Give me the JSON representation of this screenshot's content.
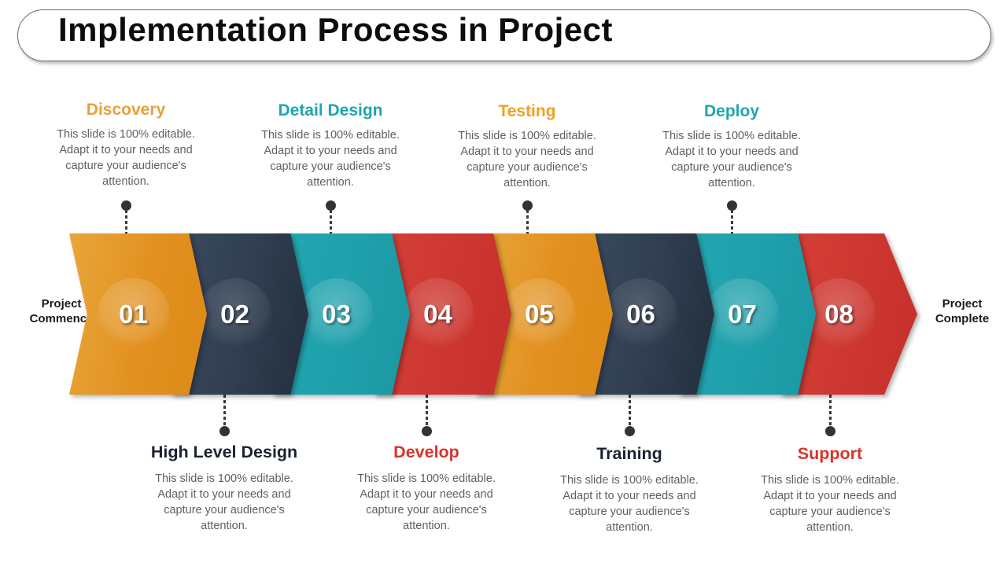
{
  "title": "Implementation  Process in Project",
  "endcaps": {
    "start": "Project\nCommence",
    "start_line1": "Project",
    "start_line2": "Commence",
    "end_line1": "Project",
    "end_line2": "Complete"
  },
  "colors": {
    "orange": "#E2901F",
    "navy": "#313F52",
    "teal": "#1FA0AB",
    "red": "#CD3731",
    "body_text": "#5F6062",
    "dark_heading": "#1A2330",
    "connector": "#333333"
  },
  "body_text": "This slide is 100% editable. Adapt it to your needs and capture your audience's attention.",
  "steps": [
    {
      "number": "01",
      "label": "Discovery",
      "color_name": "orange",
      "heading_color": "#E8A13A",
      "chip": "orange",
      "position": "top",
      "description": "This slide is 100% editable. Adapt it to your needs and capture your audience's attention."
    },
    {
      "number": "02",
      "label": "High Level Design",
      "color_name": "navy",
      "heading_color": "#1A2330",
      "chip": "navy",
      "position": "bottom",
      "description": "This slide is 100% editable. Adapt it to your needs and capture your audience's attention."
    },
    {
      "number": "03",
      "label": "Detail Design",
      "color_name": "teal",
      "heading_color": "#1FA5B0",
      "chip": "teal",
      "position": "top",
      "description": "This slide is 100% editable. Adapt it to your needs and capture your audience's attention."
    },
    {
      "number": "04",
      "label": "Develop",
      "color_name": "red",
      "heading_color": "#D8332B",
      "chip": "red",
      "position": "bottom",
      "description": "This slide is 100% editable. Adapt it to your needs and capture your audience's attention."
    },
    {
      "number": "05",
      "label": "Testing",
      "color_name": "orange",
      "heading_color": "#F2A01E",
      "chip": "orange",
      "position": "top",
      "description": "This slide is 100% editable. Adapt it to your needs and capture your audience's attention."
    },
    {
      "number": "06",
      "label": "Training",
      "color_name": "navy",
      "heading_color": "#1A2330",
      "chip": "navy",
      "position": "bottom",
      "description": "This slide is 100% editable. Adapt it to your needs and capture your audience's attention."
    },
    {
      "number": "07",
      "label": "Deploy",
      "color_name": "teal",
      "heading_color": "#1FA5B0",
      "chip": "teal",
      "position": "top",
      "description": "This slide is 100% editable. Adapt it to your needs and capture your audience's attention."
    },
    {
      "number": "08",
      "label": "Support",
      "color_name": "red",
      "heading_color": "#D8332B",
      "chip": "red",
      "position": "bottom",
      "description": "This slide is 100% editable. Adapt it to your needs and capture your audience's attention."
    }
  ]
}
